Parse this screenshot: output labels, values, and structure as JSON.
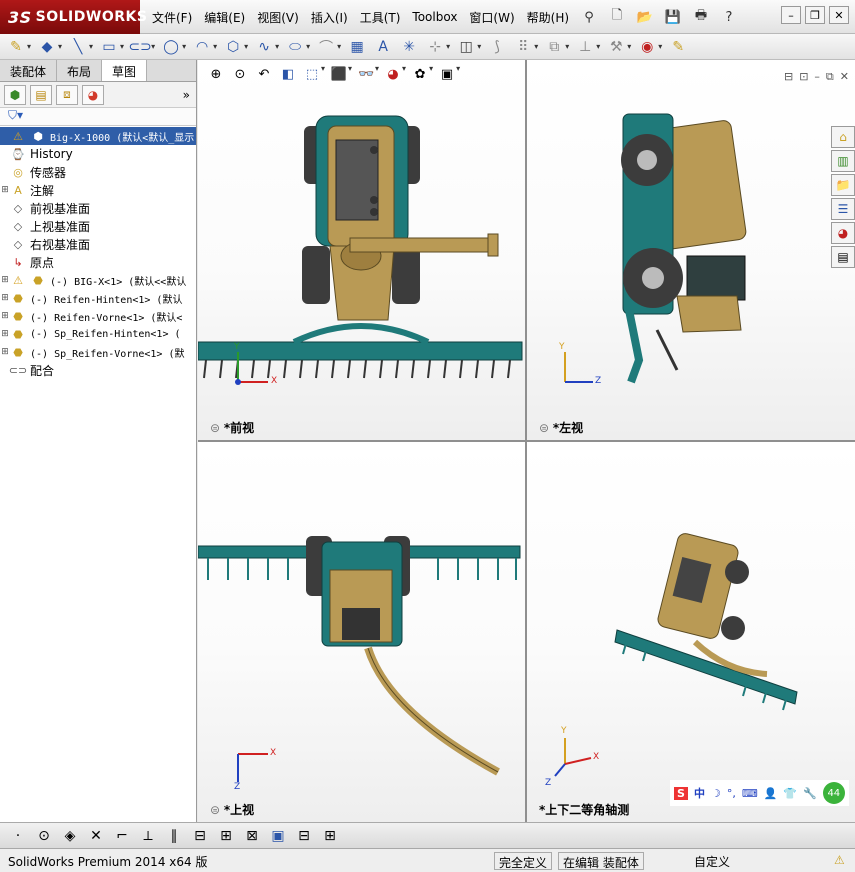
{
  "app": {
    "brand": "SOLIDWORKS",
    "brand_prefix": "3S"
  },
  "menu": [
    "文件(F)",
    "编辑(E)",
    "视图(V)",
    "插入(I)",
    "工具(T)",
    "Toolbox",
    "窗口(W)",
    "帮助(H)"
  ],
  "feature_manager": {
    "tabs": [
      "装配体",
      "布局",
      "草图"
    ],
    "active_tab": "草图",
    "tree": [
      {
        "label": "Big-X-1000 (默认<默认_显示",
        "icon": "assembly-icon",
        "warn": true,
        "selected": true,
        "mono": true
      },
      {
        "label": "History",
        "icon": "history-icon"
      },
      {
        "label": "传感器",
        "icon": "sensor-icon"
      },
      {
        "label": "注解",
        "icon": "annotation-icon",
        "expand": true
      },
      {
        "label": "前视基准面",
        "icon": "plane-icon"
      },
      {
        "label": "上视基准面",
        "icon": "plane-icon"
      },
      {
        "label": "右视基准面",
        "icon": "plane-icon"
      },
      {
        "label": "原点",
        "icon": "origin-icon"
      },
      {
        "label": "(-) BIG-X<1> (默认<<默认",
        "icon": "part-icon",
        "warn": true,
        "expand": true,
        "mono": true
      },
      {
        "label": "(-) Reifen-Hinten<1> (默认",
        "icon": "part-icon",
        "expand": true,
        "mono": true
      },
      {
        "label": "(-) Reifen-Vorne<1> (默认<",
        "icon": "part-icon",
        "expand": true,
        "mono": true
      },
      {
        "label": "(-) Sp_Reifen-Hinten<1> (",
        "icon": "part-icon",
        "expand": true,
        "mono": true
      },
      {
        "label": "(-) Sp_Reifen-Vorne<1> (默",
        "icon": "part-icon",
        "expand": true,
        "mono": true
      },
      {
        "label": "配合",
        "icon": "mate-icon"
      }
    ]
  },
  "views": {
    "front": "*前视",
    "left": "*左视",
    "top": "*上视",
    "iso": "*上下二等角轴测"
  },
  "axes": {
    "x": "X",
    "y": "Y",
    "z": "Z"
  },
  "ime": {
    "zh": "中",
    "badge": "44"
  },
  "status": {
    "product": "SolidWorks Premium 2014 x64 版",
    "under_defined": "完全定义",
    "editing": "在编辑 装配体",
    "custom": "自定义"
  },
  "colors": {
    "teal": "#1f7a7a",
    "tan": "#b99a55",
    "dark": "#3a3a3a",
    "selected": "#2f5ea8"
  }
}
